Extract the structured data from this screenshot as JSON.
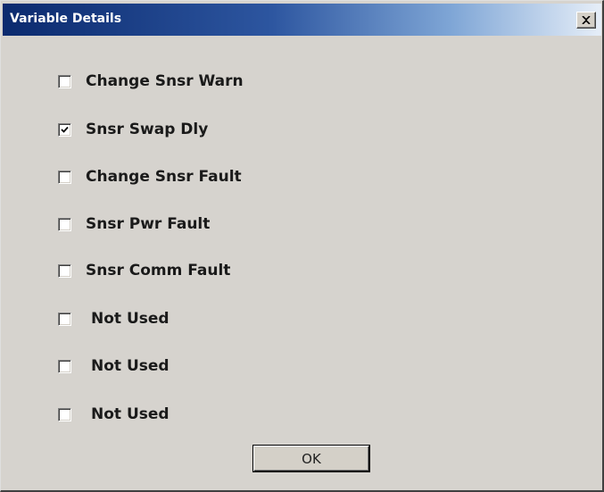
{
  "window": {
    "title": "Variable Details",
    "close_glyph": "close-icon"
  },
  "checkboxes": [
    {
      "label": "Change Snsr Warn",
      "checked": false
    },
    {
      "label": "Snsr Swap Dly",
      "checked": true
    },
    {
      "label": "Change Snsr Fault",
      "checked": false
    },
    {
      "label": "Snsr Pwr Fault",
      "checked": false
    },
    {
      "label": "Snsr Comm Fault",
      "checked": false
    },
    {
      "label": "Not Used",
      "checked": false
    },
    {
      "label": "Not Used",
      "checked": false
    },
    {
      "label": "Not Used",
      "checked": false
    }
  ],
  "buttons": {
    "ok_label": "OK"
  },
  "colors": {
    "title_bar_start": "#0b2a6e",
    "title_bar_end": "#e6eef8",
    "dialog_face": "#d6d3ce"
  }
}
